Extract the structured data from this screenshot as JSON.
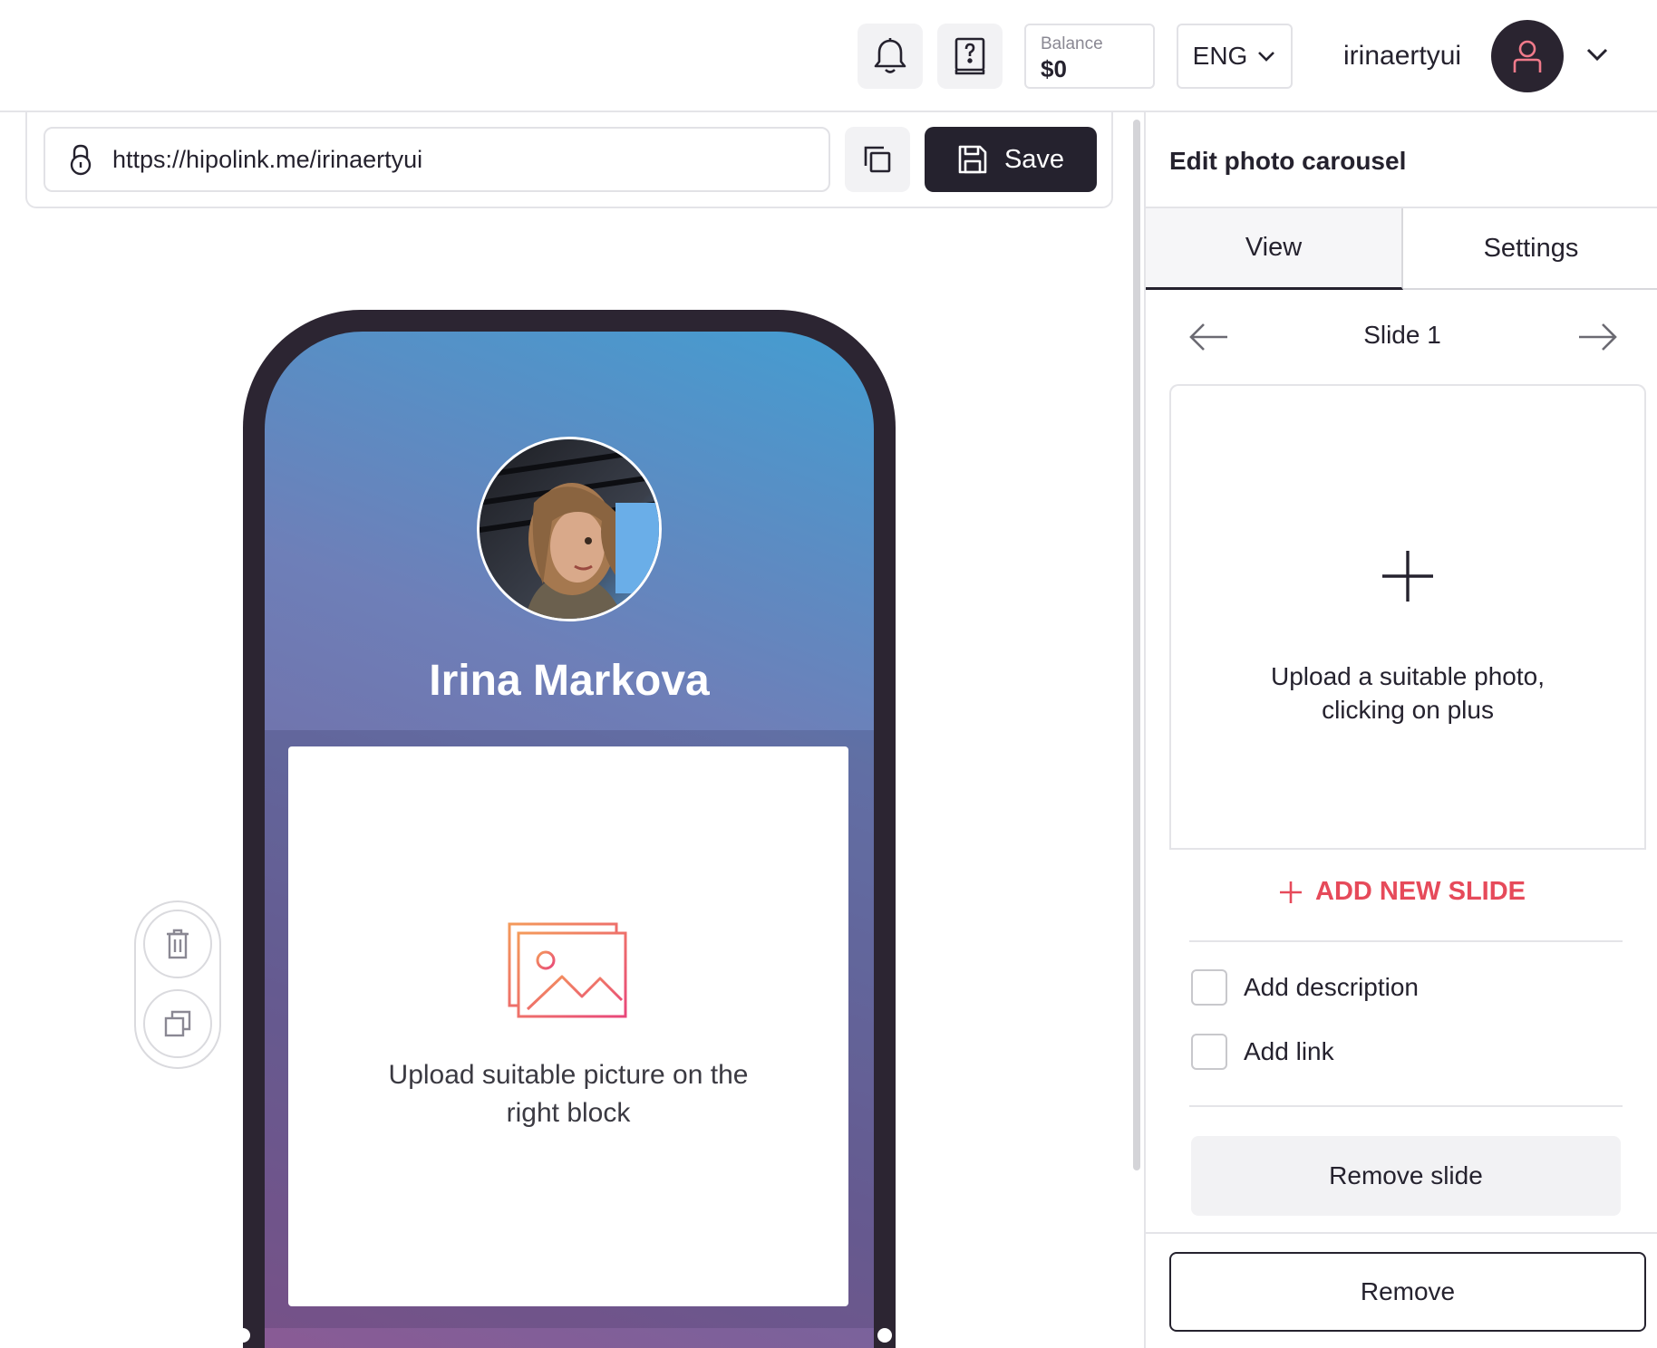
{
  "header": {
    "notifications_icon": "bell-icon",
    "help_icon": "help-book-icon",
    "balance_label": "Balance",
    "balance_value": "$0",
    "language": "ENG",
    "username": "irinaertyui"
  },
  "editor": {
    "url": "https://hipolink.me/irinaertyui",
    "save_label": "Save"
  },
  "preview": {
    "profile_name": "Irina Markova",
    "carousel_placeholder": "Upload suitable picture on the right block"
  },
  "panel": {
    "title": "Edit photo carousel",
    "tabs": [
      {
        "label": "View",
        "active": true
      },
      {
        "label": "Settings",
        "active": false
      }
    ],
    "slide_label": "Slide 1",
    "upload_text_line1": "Upload a suitable photo,",
    "upload_text_line2": "clicking on plus",
    "add_new_slide": "ADD NEW SLIDE",
    "add_description": "Add description",
    "add_link": "Add link",
    "remove_slide": "Remove slide",
    "remove": "Remove"
  },
  "colors": {
    "accent": "#e64a5a",
    "dark": "#25222e"
  }
}
